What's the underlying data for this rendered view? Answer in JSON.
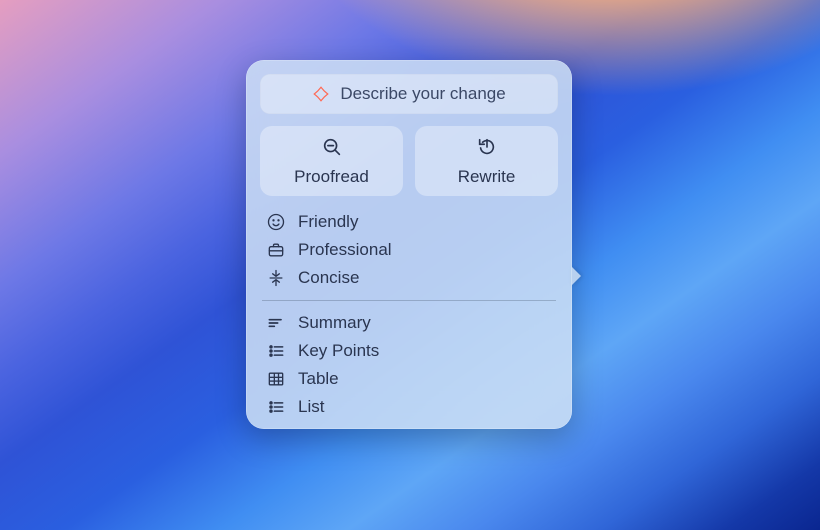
{
  "prompt": {
    "placeholder": "Describe your change"
  },
  "actions": {
    "proofread": {
      "label": "Proofread"
    },
    "rewrite": {
      "label": "Rewrite"
    }
  },
  "tone_items": [
    {
      "id": "friendly",
      "label": "Friendly"
    },
    {
      "id": "professional",
      "label": "Professional"
    },
    {
      "id": "concise",
      "label": "Concise"
    }
  ],
  "format_items": [
    {
      "id": "summary",
      "label": "Summary"
    },
    {
      "id": "keypoints",
      "label": "Key Points"
    },
    {
      "id": "table",
      "label": "Table"
    },
    {
      "id": "list",
      "label": "List"
    }
  ]
}
